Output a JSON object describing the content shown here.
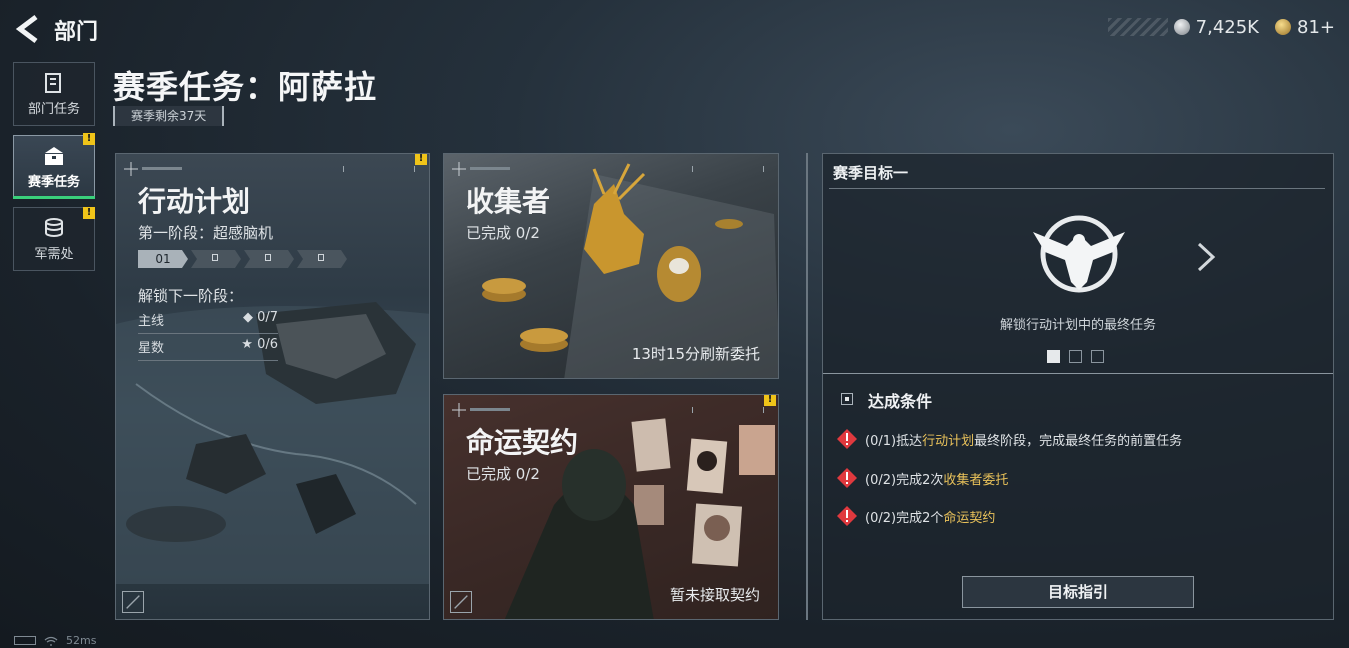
{
  "header": {
    "title": "部门"
  },
  "currency": [
    {
      "icon": "silver-coin-icon",
      "value": "7,425K",
      "color": "#c8ccd0"
    },
    {
      "icon": "gold-coin-icon",
      "value": "81+",
      "color": "#d8b15a"
    }
  ],
  "sidebar": {
    "items": [
      {
        "label": "部门任务",
        "icon": "clipboard-icon"
      },
      {
        "label": "赛季任务",
        "icon": "crate-icon",
        "active": true,
        "badge": "!"
      },
      {
        "label": "军需处",
        "icon": "coin-stack-icon",
        "badge": "!"
      }
    ]
  },
  "page": {
    "title": "赛季任务：阿萨拉",
    "season_left": "赛季剩余37天"
  },
  "cards": {
    "action_plan": {
      "title": "行动计划",
      "stage": "第一阶段：超感脑机",
      "stage_steps": [
        "01"
      ],
      "unlock_label": "解锁下一阶段：",
      "rows": [
        {
          "label": "主线",
          "symbol": "◆",
          "value": "0/7"
        },
        {
          "label": "星数",
          "symbol": "★",
          "value": "0/6"
        }
      ],
      "badge": "!"
    },
    "collector": {
      "title": "收集者",
      "progress": "已完成 0/2",
      "refresh": "13时15分刷新委托"
    },
    "fate_contract": {
      "title": "命运契约",
      "progress": "已完成 0/2",
      "status": "暂未接取契约",
      "badge": "!"
    }
  },
  "goal": {
    "title": "赛季目标一",
    "emblem_caption": "解锁行动计划中的最终任务",
    "conditions_title": "达成条件",
    "conditions": [
      {
        "prefix": "(0/1)抵达",
        "highlight": "行动计划",
        "suffix": "最终阶段，完成最终任务的前置任务"
      },
      {
        "prefix": "(0/2)完成2次",
        "highlight": "收集者委托",
        "suffix": ""
      },
      {
        "prefix": "(0/2)完成2个",
        "highlight": "命运契约",
        "suffix": ""
      }
    ],
    "guide_button": "目标指引"
  },
  "status_bar": {
    "ping": "52ms"
  },
  "colors": {
    "accent_green": "#3ad07b",
    "badge_yellow": "#f0c419",
    "highlight_gold": "#e8c15a",
    "warn_red": "#e0393e"
  }
}
